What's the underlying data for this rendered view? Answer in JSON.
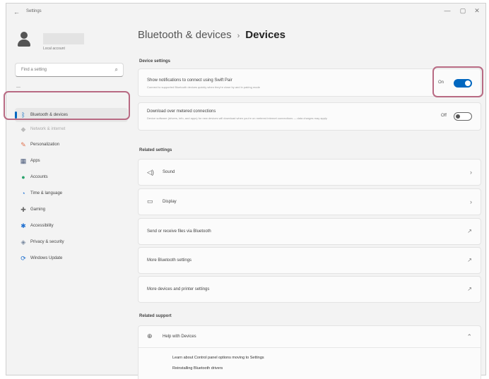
{
  "window": {
    "title": "Settings",
    "back": "←",
    "min": "—",
    "max": "▢",
    "close": "✕"
  },
  "profile": {
    "name_sub": "Local account"
  },
  "search": {
    "placeholder": "Find a setting"
  },
  "sidebar": {
    "dash": "—",
    "items": [
      {
        "label": "Bluetooth & devices",
        "icon": "bluetooth-icon",
        "glyph": "ᛒ",
        "color": "#0067c0"
      },
      {
        "label": "Network & internet",
        "icon": "network-icon",
        "glyph": "◆",
        "color": "#bbbbbb"
      },
      {
        "label": "Personalization",
        "icon": "brush-icon",
        "glyph": "✎",
        "color": "#e0724e"
      },
      {
        "label": "Apps",
        "icon": "apps-icon",
        "glyph": "▦",
        "color": "#4a5a7a"
      },
      {
        "label": "Accounts",
        "icon": "accounts-icon",
        "glyph": "●",
        "color": "#2aa36b"
      },
      {
        "label": "Time & language",
        "icon": "time-language-icon",
        "glyph": "◔",
        "color": "#2b7bd6"
      },
      {
        "label": "Gaming",
        "icon": "gaming-icon",
        "glyph": "✚",
        "color": "#6b6b6b"
      },
      {
        "label": "Accessibility",
        "icon": "accessibility-icon",
        "glyph": "✱",
        "color": "#1f6fd0"
      },
      {
        "label": "Privacy & security",
        "icon": "shield-icon",
        "glyph": "◈",
        "color": "#7a8aa0"
      },
      {
        "label": "Windows Update",
        "icon": "windows-update-icon",
        "glyph": "⟳",
        "color": "#1e6fcf"
      }
    ]
  },
  "breadcrumb": {
    "parent": "Bluetooth & devices",
    "sep": "›",
    "current": "Devices"
  },
  "device_settings": {
    "heading": "Device settings",
    "notifications": {
      "title": "Show notifications to connect using Swift Pair",
      "desc": "Connect to supported Bluetooth devices quickly when they're close by and in pairing mode",
      "state": "On"
    },
    "metered": {
      "title": "Download over metered connections",
      "desc": "Device software (drivers, info, and apps) for new devices will download when you're on metered internet connections — data charges may apply",
      "state": "Off"
    }
  },
  "related_settings": {
    "heading": "Related settings",
    "items": [
      {
        "label": "Sound",
        "icon": "speaker-icon",
        "glyph": "🔈",
        "action": "›"
      },
      {
        "label": "Display",
        "icon": "monitor-icon",
        "glyph": "▭",
        "action": "›"
      },
      {
        "label": "Send or receive files via Bluetooth",
        "action": "↗"
      },
      {
        "label": "More Bluetooth settings",
        "action": "↗"
      },
      {
        "label": "More devices and printer settings",
        "action": "↗"
      }
    ]
  },
  "related_support": {
    "heading": "Related support",
    "help": {
      "label": "Help with Devices",
      "icon": "globe-icon",
      "glyph": "⊕",
      "action": "⌃"
    },
    "links": [
      "Learn about Control panel options moving to Settings",
      "Reinstalling Bluetooth drivers"
    ]
  },
  "colors": {
    "accent": "#0067c0",
    "highlight": "#b86a83"
  }
}
